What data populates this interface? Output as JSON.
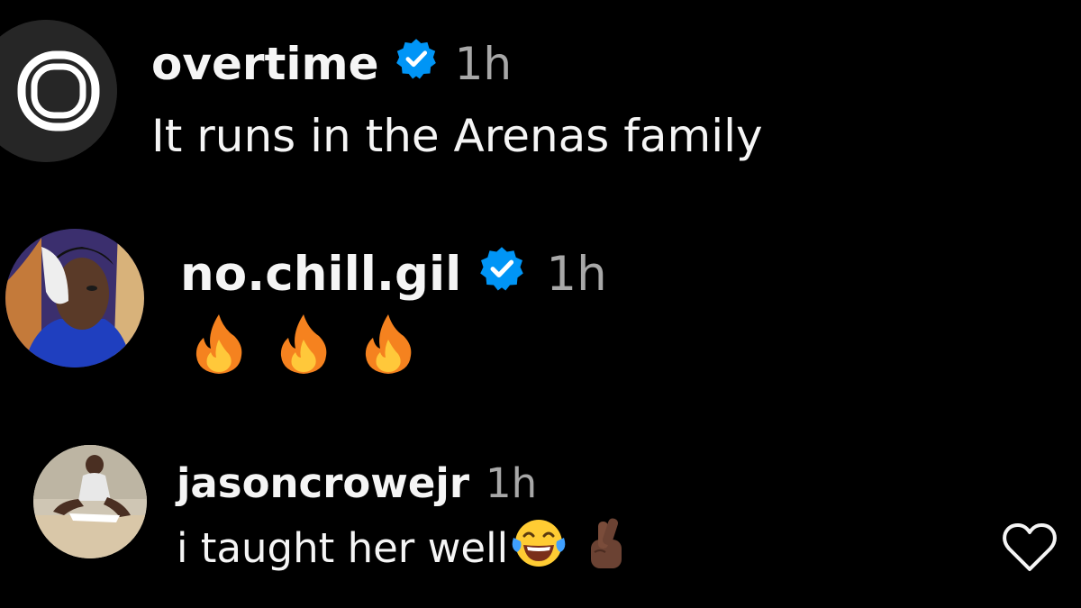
{
  "comments": [
    {
      "username": "overtime",
      "verified": true,
      "time": "1h",
      "text": "It runs in the Arenas family",
      "avatar": "overtime-logo-avatar"
    },
    {
      "username": "no.chill.gil",
      "verified": true,
      "time": "1h",
      "text": "",
      "emojis": [
        "fire-icon",
        "fire-icon",
        "fire-icon"
      ],
      "avatar": "user-photo-avatar"
    },
    {
      "username": "jasoncrowejr",
      "verified": false,
      "time": "1h",
      "text": "i taught her well",
      "emojis": [
        "tears-of-joy-icon",
        "crossed-fingers-icon"
      ],
      "avatar": "user-photo-avatar"
    }
  ],
  "colors": {
    "background": "#000000",
    "text": "#f5f5f5",
    "muted": "#a8a8a8",
    "verified": "#0095f6"
  }
}
